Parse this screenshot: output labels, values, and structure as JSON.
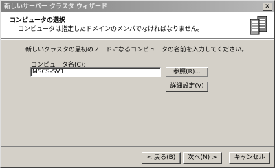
{
  "window": {
    "title": "新しいサーバー クラスタ ウィザード",
    "close_symbol": "✕"
  },
  "header": {
    "title": "コンピュータの選択",
    "subtitle": "コンピュータは指定したドメインのメンバでなければなりません。",
    "icon": "server-cluster-icon"
  },
  "body": {
    "instruction": "新しいクラスタの最初のノードになるコンピュータの名前を入力してください。",
    "computer_label_prefix": "コンピュータ名(",
    "computer_label_key": "C",
    "computer_label_suffix": "):",
    "computer_name": "MSCS-SV1",
    "browse_label": "参照(R)...",
    "advanced_label": "詳細設定(V)"
  },
  "footer": {
    "back_label": "< 戻る(B)",
    "next_label": "次へ(N) >",
    "cancel_label": "キャンセル"
  }
}
